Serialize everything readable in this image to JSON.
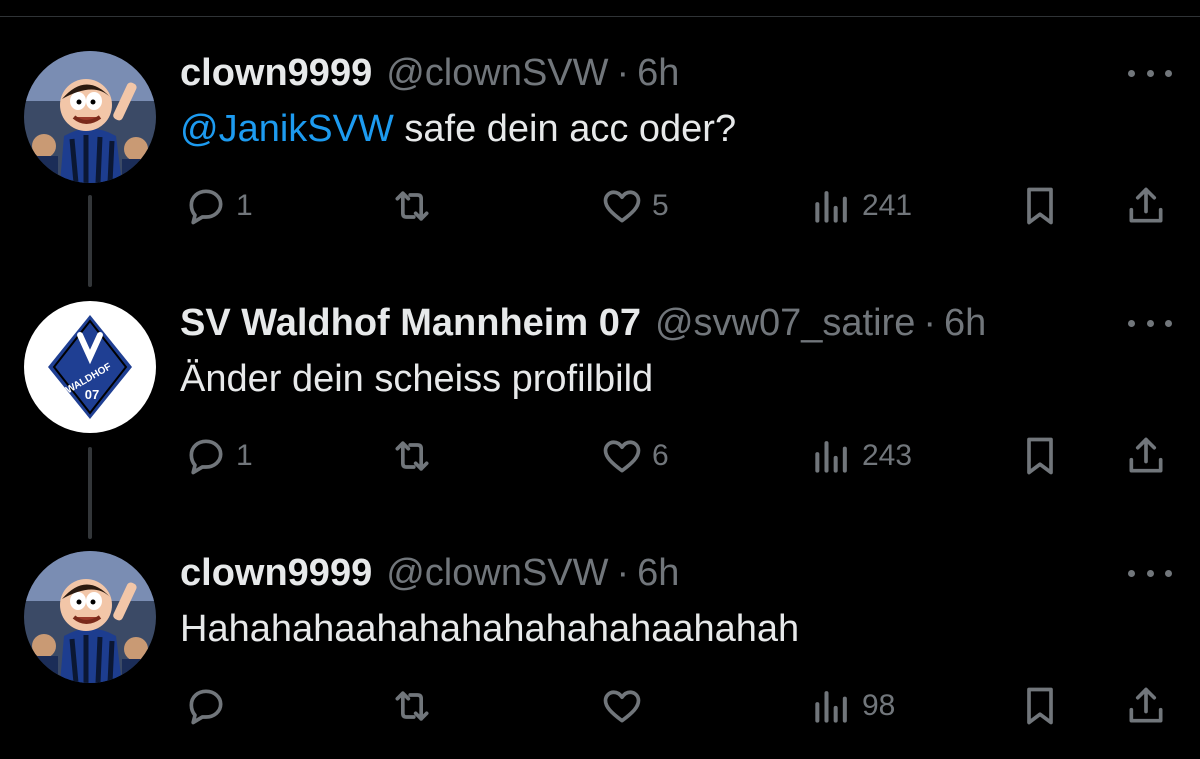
{
  "tweets": [
    {
      "display_name": "clown9999",
      "handle": "@clownSVW",
      "separator": "·",
      "time": "6h",
      "mention": "@JanikSVW",
      "text": "safe dein acc oder?",
      "avatar": "family-guy-cartoon-avatar",
      "replies": "1",
      "likes": "5",
      "views": "241"
    },
    {
      "display_name": "SV Waldhof Mannheim 07",
      "handle": "@svw07_satire",
      "separator": "·",
      "time": "6h",
      "mention": "",
      "text": "Änder dein scheiss profilbild",
      "avatar": "waldhof-crest-avatar",
      "avatar_crest_text_1": "WALDHOF",
      "avatar_crest_text_2": "07",
      "replies": "1",
      "likes": "6",
      "views": "243"
    },
    {
      "display_name": "clown9999",
      "handle": "@clownSVW",
      "separator": "·",
      "time": "6h",
      "mention": "",
      "text": "Hahahahaahahahahahahahaahahah",
      "avatar": "family-guy-cartoon-avatar",
      "replies": "",
      "likes": "",
      "views": "98"
    }
  ],
  "icons": {
    "reply": "reply-icon",
    "retweet": "retweet-icon",
    "like": "like-icon",
    "views": "views-icon",
    "bookmark": "bookmark-icon",
    "share": "share-icon",
    "more": "more-icon"
  },
  "colors": {
    "background": "#000000",
    "text": "#e7e9ea",
    "muted": "#71767b",
    "link": "#1d9bf0",
    "thread_line": "#333639",
    "crest_blue": "#1f3f93"
  }
}
